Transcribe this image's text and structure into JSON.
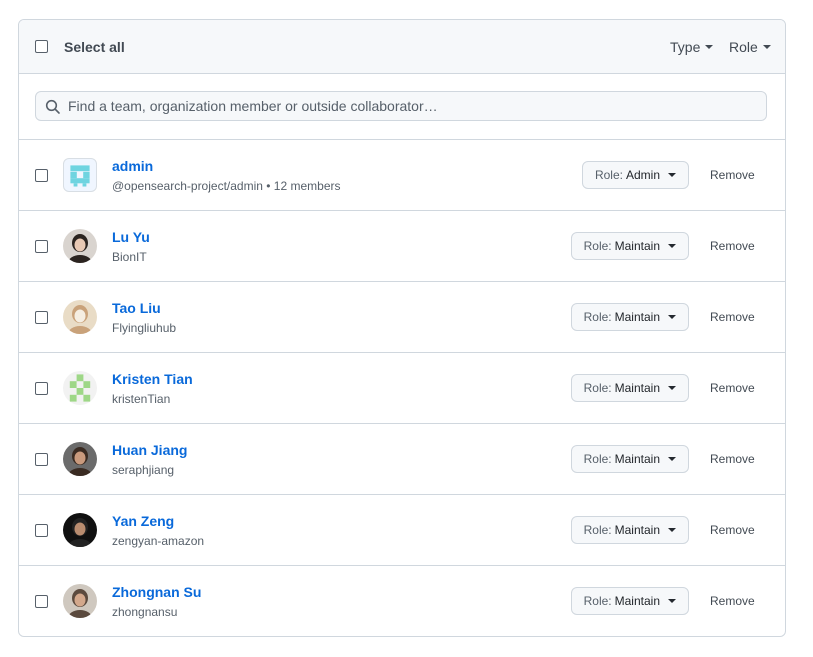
{
  "header": {
    "select_all_label": "Select all",
    "type_filter_label": "Type",
    "role_filter_label": "Role"
  },
  "search": {
    "placeholder": "Find a team, organization member or outside collaborator…"
  },
  "members": [
    {
      "name": "admin",
      "sub": "@opensearch-project/admin • 12 members",
      "role_prefix": "Role:",
      "role": "Admin",
      "remove_label": "Remove",
      "avatar_icon": "team-identicon"
    },
    {
      "name": "Lu Yu",
      "sub": "BionIT",
      "role_prefix": "Role:",
      "role": "Maintain",
      "remove_label": "Remove",
      "avatar_icon": "user-photo"
    },
    {
      "name": "Tao Liu",
      "sub": "Flyingliuhub",
      "role_prefix": "Role:",
      "role": "Maintain",
      "remove_label": "Remove",
      "avatar_icon": "user-photo"
    },
    {
      "name": "Kristen Tian",
      "sub": "kristenTian",
      "role_prefix": "Role:",
      "role": "Maintain",
      "remove_label": "Remove",
      "avatar_icon": "identicon"
    },
    {
      "name": "Huan Jiang",
      "sub": "seraphjiang",
      "role_prefix": "Role:",
      "role": "Maintain",
      "remove_label": "Remove",
      "avatar_icon": "user-photo"
    },
    {
      "name": "Yan Zeng",
      "sub": "zengyan-amazon",
      "role_prefix": "Role:",
      "role": "Maintain",
      "remove_label": "Remove",
      "avatar_icon": "user-photo"
    },
    {
      "name": "Zhongnan Su",
      "sub": "zhongnansu",
      "role_prefix": "Role:",
      "role": "Maintain",
      "remove_label": "Remove",
      "avatar_icon": "user-photo"
    }
  ],
  "colors": {
    "link": "#0969da",
    "border": "#d0d7de",
    "header_bg": "#f6f8fa",
    "team_identicon": "#6fd4e0",
    "user_identicon": "#9ed787"
  }
}
